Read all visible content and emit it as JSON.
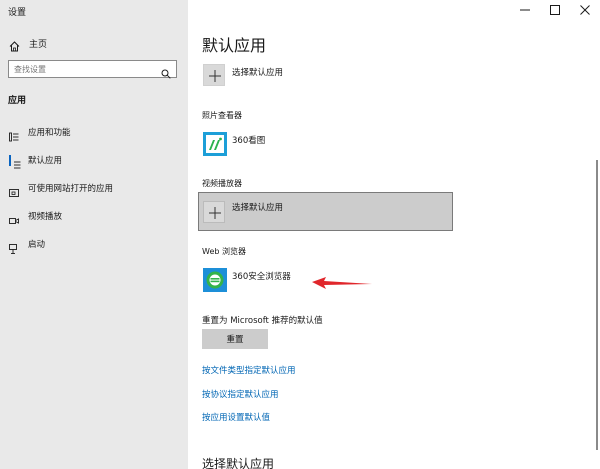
{
  "window": {
    "title": "设置"
  },
  "sidebar": {
    "home_label": "主页",
    "search_placeholder": "查找设置",
    "section_label": "应用",
    "items": [
      {
        "label": "应用和功能",
        "icon": "apps-list-icon",
        "selected": false
      },
      {
        "label": "默认应用",
        "icon": "default-apps-icon",
        "selected": true
      },
      {
        "label": "可使用网站打开的应用",
        "icon": "websites-apps-icon",
        "selected": false
      },
      {
        "label": "视频播放",
        "icon": "video-icon",
        "selected": false
      },
      {
        "label": "启动",
        "icon": "startup-icon",
        "selected": false
      }
    ]
  },
  "main": {
    "title": "默认应用",
    "top_row": {
      "label": "选择默认应用"
    },
    "photo": {
      "group_label": "照片查看器",
      "app_name": "360看图"
    },
    "video": {
      "group_label": "视频播放器",
      "app_name": "选择默认应用"
    },
    "web": {
      "group_label": "Web 浏览器",
      "app_name": "360安全浏览器"
    },
    "reset": {
      "label": "重置为 Microsoft 推荐的默认值",
      "button": "重置"
    },
    "links": [
      "按文件类型指定默认应用",
      "按协议指定默认应用",
      "按应用设置默认值"
    ],
    "bottom_heading": "选择默认应用"
  },
  "colors": {
    "sidebar_bg": "#e9e9e9",
    "accent": "#0a64c0",
    "link": "#0066b4",
    "arrow": "#e0262b",
    "highlight_bg": "#cccccc"
  }
}
